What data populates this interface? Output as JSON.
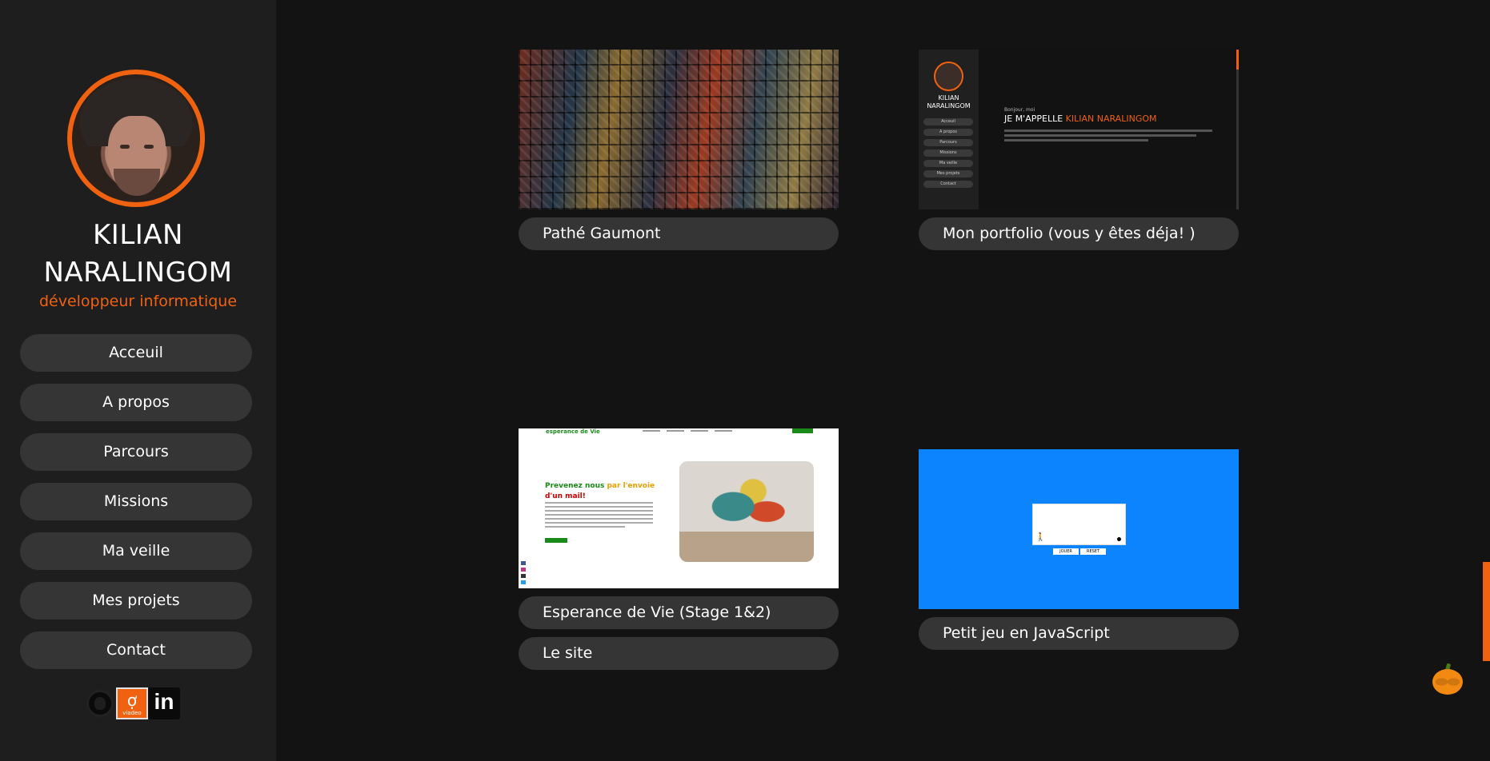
{
  "profile": {
    "name_line1": "KILIAN",
    "name_line2": "NARALINGOM",
    "subtitle": "développeur informatique"
  },
  "nav": [
    {
      "label": "Acceuil"
    },
    {
      "label": "A propos"
    },
    {
      "label": "Parcours"
    },
    {
      "label": "Missions"
    },
    {
      "label": "Ma veille"
    },
    {
      "label": "Mes projets"
    },
    {
      "label": "Contact"
    }
  ],
  "social": {
    "icons": [
      "github-icon",
      "viadeo-icon",
      "linkedin-icon"
    ],
    "viadeo_glyph": "ợ",
    "viadeo_text": "viadeo",
    "linkedin_glyph": "in"
  },
  "projects": [
    {
      "title": "Pathé Gaumont",
      "thumbnail": "movie-posters-mosaic"
    },
    {
      "title": "Mon portfolio (vous y êtes déja! )",
      "thumbnail": "portfolio-preview"
    },
    {
      "title": "Esperance de Vie (Stage 1&2)",
      "thumbnail": "esperance-de-vie-preview",
      "link_label": "Le site"
    },
    {
      "title": "Petit jeu en JavaScript",
      "thumbnail": "js-game-preview"
    }
  ],
  "portfolio_preview": {
    "name_line1": "KILIAN",
    "name_line2": "NARALINGOM",
    "hello": "Bonjour, moi",
    "heading_prefix": "JE M'APPELLE ",
    "heading_highlight": "KILIAN NARALINGOM",
    "nav": [
      "Acceuil",
      "A propos",
      "Parcours",
      "Missions",
      "Ma veille",
      "Mes projets",
      "Contact"
    ]
  },
  "esperance_preview": {
    "logo": "esperance de Vie",
    "heading_green": "Prevenez nous ",
    "heading_yellow": "par l'envoie ",
    "heading_red": "d'un mail!"
  },
  "game_preview": {
    "btn1": "JOUER",
    "btn2": "RESET"
  },
  "colors": {
    "accent": "#f0620f",
    "sidebar_bg": "#1e1e1e",
    "page_bg": "#131313",
    "pill_bg": "#353535",
    "game_bg": "#0b84fe"
  },
  "decor": {
    "pumpkin_icon": "pumpkin-icon"
  }
}
